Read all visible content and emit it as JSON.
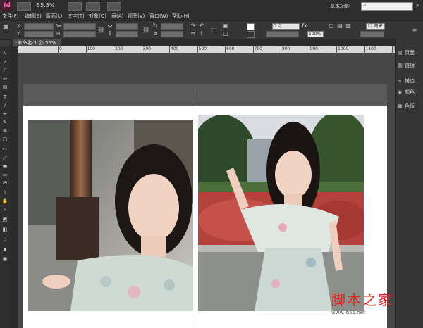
{
  "app": {
    "logo": "Id",
    "zoom": "55.5%",
    "workspace": "基本功能"
  },
  "menu": [
    "文件(F)",
    "编辑(E)",
    "版面(L)",
    "文字(T)",
    "对象(O)",
    "表(A)",
    "视图(V)",
    "窗口(W)",
    "帮助(H)"
  ],
  "control": {
    "x_label": "X:",
    "y_label": "Y:",
    "w_label": "W:",
    "h_label": "H:",
    "x_value": "0 毫米",
    "y_value": "0 毫米",
    "stroke_value": "0 点",
    "opacity_value": "100%",
    "size_value": "12 毫米"
  },
  "document": {
    "tab_label": "*未命名-1 @ 56%"
  },
  "ruler": {
    "ticks": [
      "0",
      "100",
      "200",
      "300",
      "400",
      "500",
      "600",
      "700",
      "800",
      "900",
      "1000",
      "1100",
      "1200"
    ]
  },
  "panels": [
    {
      "icon": "page-icon",
      "label": "页面"
    },
    {
      "icon": "link-icon",
      "label": "链接"
    },
    {
      "icon": "stroke-icon",
      "label": "描边"
    },
    {
      "icon": "color-icon",
      "label": "颜色"
    },
    {
      "icon": "swatch-icon",
      "label": "色板"
    }
  ],
  "watermark": {
    "text": "脚本之家",
    "url": "www.jb51.net"
  }
}
